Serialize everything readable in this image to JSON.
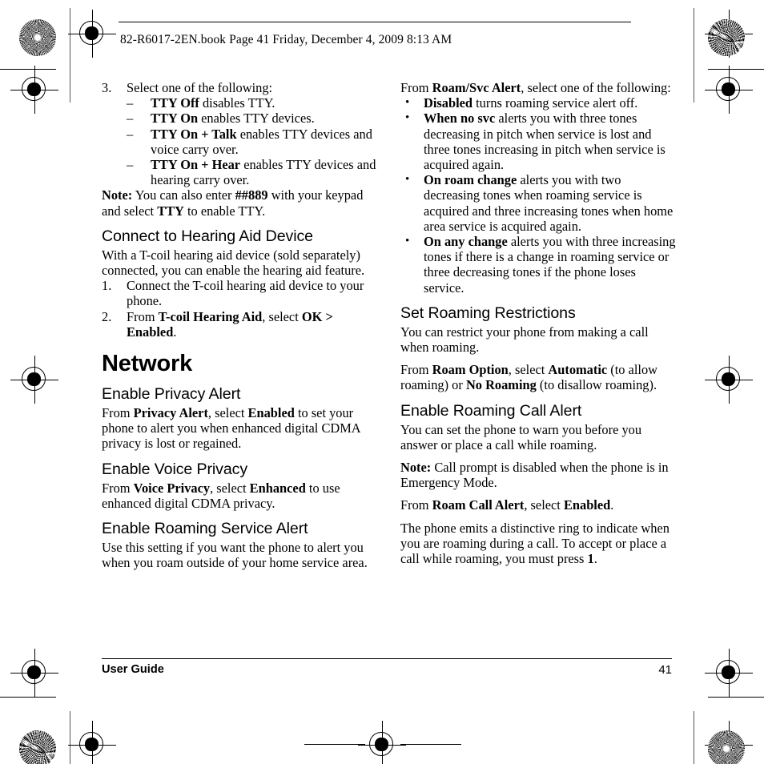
{
  "file_header": {
    "text": "82-R6017-2EN.book  Page 41  Friday, December 4, 2009  8:13 AM"
  },
  "footer": {
    "left_label": "User Guide",
    "page_number": "41"
  },
  "left_column": {
    "step3": {
      "marker": "3.",
      "text": "Select one of the following:",
      "sub_items": [
        {
          "marker": "–",
          "bold": "TTY Off",
          "rest": " disables TTY."
        },
        {
          "marker": "–",
          "bold": "TTY On",
          "rest": " enables TTY devices."
        },
        {
          "marker": "–",
          "bold": "TTY On + Talk",
          "rest": " enables TTY devices and voice carry over."
        },
        {
          "marker": "–",
          "bold": "TTY On + Hear",
          "rest": " enables TTY devices and hearing carry over."
        }
      ]
    },
    "note": {
      "label": "Note:",
      "part1": " You can also enter ",
      "bold1": "##889",
      "part2": " with your keypad and select ",
      "bold2": "TTY",
      "part3": " to enable TTY."
    },
    "hearing_aid": {
      "heading": "Connect to Hearing Aid Device",
      "intro": "With a T-coil hearing aid device (sold separately) connected, you can enable the hearing aid feature.",
      "steps": [
        {
          "marker": "1.",
          "text": "Connect the T-coil hearing aid device to your phone."
        },
        {
          "marker": "2.",
          "pre": "From ",
          "bold1": "T-coil Hearing Aid",
          "mid": ", select ",
          "bold2": "OK > Enabled",
          "post": "."
        }
      ]
    },
    "network": {
      "heading": "Network",
      "privacy_alert": {
        "heading": "Enable Privacy Alert",
        "pre": "From ",
        "bold1": "Privacy Alert",
        "mid": ", select ",
        "bold2": "Enabled",
        "post": " to set your phone to alert you when enhanced digital CDMA privacy is lost or regained."
      },
      "voice_privacy": {
        "heading": "Enable Voice Privacy",
        "pre": "From ",
        "bold1": "Voice Privacy",
        "mid": ", select ",
        "bold2": "Enhanced",
        "post": " to use enhanced digital CDMA privacy."
      },
      "roaming_service_alert": {
        "heading": "Enable Roaming Service Alert",
        "body": "Use this setting if you want the phone to alert you when you roam outside of your home service area."
      }
    }
  },
  "right_column": {
    "roam_svc_alert": {
      "pre": "From ",
      "bold": "Roam/Svc Alert",
      "post": ", select one of the following:",
      "options": [
        {
          "marker": "•",
          "bold": "Disabled",
          "rest": " turns roaming service alert off."
        },
        {
          "marker": "•",
          "bold": "When no svc",
          "rest": " alerts you with three tones decreasing in pitch when service is lost and three tones increasing in pitch when service is acquired again."
        },
        {
          "marker": "•",
          "bold": "On roam change",
          "rest": " alerts you with two decreasing tones when roaming service is acquired and three increasing tones when home area service is acquired again."
        },
        {
          "marker": "•",
          "bold": "On any change",
          "rest": " alerts you with three increasing tones if there is a change in roaming service or three decreasing tones if the phone loses service."
        }
      ]
    },
    "roaming_restrictions": {
      "heading": "Set Roaming Restrictions",
      "intro": "You can restrict your phone from making a call when roaming.",
      "pre": "From ",
      "bold1": "Roam Option",
      "mid1": ", select ",
      "bold2": "Automatic",
      "mid2": " (to allow roaming) or ",
      "bold3": "No Roaming",
      "post": " (to disallow roaming)."
    },
    "roaming_call_alert": {
      "heading": "Enable Roaming Call Alert",
      "intro": "You can set the phone to warn you before you answer or place a call while roaming.",
      "note_label": "Note:",
      "note_text": " Call prompt is disabled when the phone is in Emergency Mode.",
      "pre": "From ",
      "bold1": "Roam Call Alert",
      "mid": ", select ",
      "bold2": "Enabled",
      "post": ".",
      "closing_pre": "The phone emits a distinctive ring to indicate when you are roaming during a call. To accept or place a call while roaming, you must press ",
      "closing_bold": "1",
      "closing_post": "."
    }
  }
}
